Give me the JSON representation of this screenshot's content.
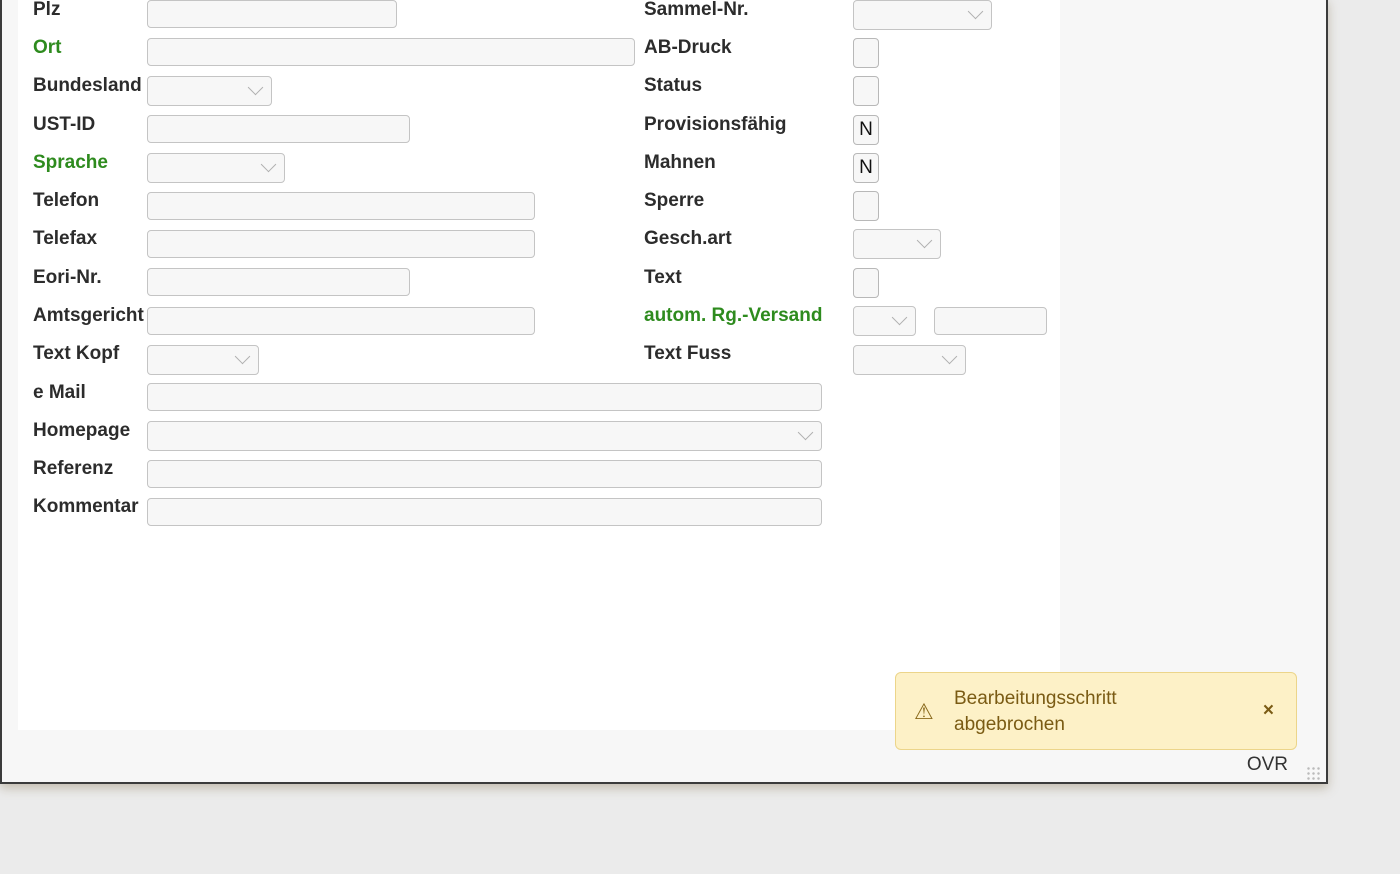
{
  "form": {
    "left": {
      "plz": "Plz",
      "ort": "Ort",
      "bundesland": "Bundesland",
      "ust_id": "UST-ID",
      "sprache": "Sprache",
      "telefon": "Telefon",
      "telefax": "Telefax",
      "eori": "Eori-Nr.",
      "amtsgericht": "Amtsgericht",
      "text_kopf": "Text Kopf",
      "email": "e Mail",
      "homepage": "Homepage",
      "referenz": "Referenz",
      "kommentar": "Kommentar"
    },
    "right": {
      "sammel_nr": "Sammel-Nr.",
      "ab_druck": "AB-Druck",
      "status": "Status",
      "provisionsfaehig": "Provisionsfähig",
      "mahnen": "Mahnen",
      "sperre": "Sperre",
      "gesch_art": "Gesch.art",
      "text": "Text",
      "autom_rg": "autom. Rg.-Versand",
      "text_fuss": "Text Fuss"
    },
    "values": {
      "provisionsfaehig": "N",
      "mahnen": "N"
    }
  },
  "toast": {
    "icon": "warning-icon",
    "message": "Bearbeitungsschritt abgebrochen",
    "close": "×"
  },
  "statusbar": {
    "mode": "OVR"
  },
  "colors": {
    "required_label": "#2e8b1e",
    "toast_bg": "#fdf1c7"
  }
}
